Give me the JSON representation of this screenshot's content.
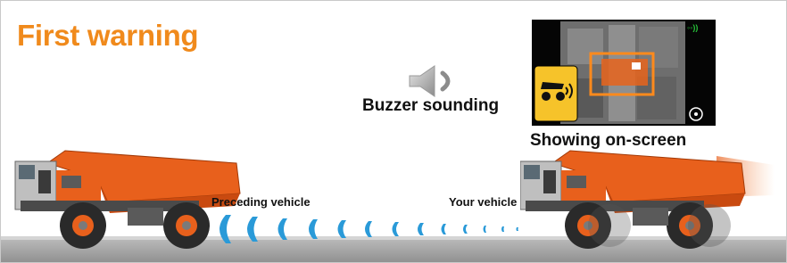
{
  "title": "First warning",
  "buzzer": {
    "label": "Buzzer sounding",
    "icon": "speaker-icon"
  },
  "screen": {
    "label": "Showing on-screen",
    "icon": "truck-sensor-icon"
  },
  "labels": {
    "preceding": "Preceding vehicle",
    "yours": "Your vehicle"
  },
  "colors": {
    "title": "#f08a1c",
    "truck_body": "#e8601c",
    "wave": "#2a9ad8",
    "warning_bg": "#f6c32a"
  }
}
